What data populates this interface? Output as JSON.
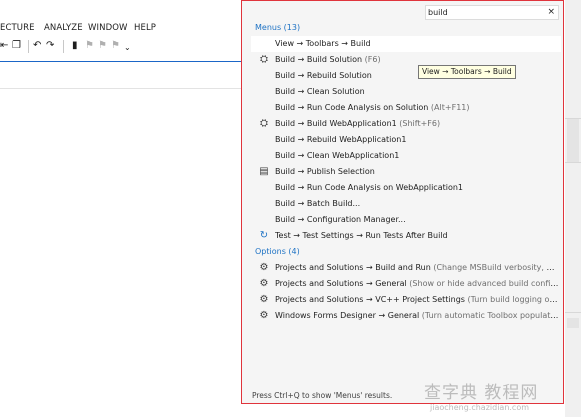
{
  "menubar": {
    "items": [
      "ECTURE",
      "ANALYZE",
      "WINDOW",
      "HELP"
    ]
  },
  "search": {
    "value": "build",
    "clear_glyph": "×"
  },
  "groups": {
    "menus_header": "Menus (13)",
    "options_header": "Options (4)"
  },
  "results": [
    {
      "text": "View → Toolbars → Build",
      "hint": "",
      "icon": "",
      "selected": true
    },
    {
      "text": "Build → Build Solution",
      "hint": " (F6)",
      "icon": "build-solution-icon",
      "selected": false
    },
    {
      "text": "Build → Rebuild Solution",
      "hint": "",
      "icon": "",
      "selected": false
    },
    {
      "text": "Build → Clean Solution",
      "hint": "",
      "icon": "",
      "selected": false
    },
    {
      "text": "Build → Run Code Analysis on Solution",
      "hint": " (Alt+F11)",
      "icon": "",
      "selected": false
    },
    {
      "text": "Build → Build WebApplication1",
      "hint": " (Shift+F6)",
      "icon": "build-project-icon",
      "selected": false
    },
    {
      "text": "Build → Rebuild WebApplication1",
      "hint": "",
      "icon": "",
      "selected": false
    },
    {
      "text": "Build → Clean WebApplication1",
      "hint": "",
      "icon": "",
      "selected": false
    },
    {
      "text": "Build → Publish Selection",
      "hint": "",
      "icon": "publish-icon",
      "selected": false
    },
    {
      "text": "Build → Run Code Analysis on WebApplication1",
      "hint": "",
      "icon": "",
      "selected": false
    },
    {
      "text": "Build → Batch Build...",
      "hint": "",
      "icon": "",
      "selected": false
    },
    {
      "text": "Build → Configuration Manager...",
      "hint": "",
      "icon": "",
      "selected": false
    },
    {
      "text": "Test → Test Settings → Run Tests After Build",
      "hint": "",
      "icon": "test-settings-icon",
      "selected": false
    }
  ],
  "options": [
    {
      "text": "Projects and Solutions → Build and Run",
      "hint": " (Change MSBuild verbosity, Change the nu..."
    },
    {
      "text": "Projects and Solutions → General",
      "hint": " (Show or hide advanced build configurations, Sho..."
    },
    {
      "text": "Projects and Solutions → VC++ Project Settings",
      "hint": " (Turn build logging on or off, Turn..."
    },
    {
      "text": "Windows Forms Designer → General",
      "hint": " (Turn automatic Toolbox population after rebui..."
    }
  ],
  "tooltip": "View → Toolbars → Build",
  "footer": "Press Ctrl+Q to show 'Menus' results.",
  "watermark": {
    "main": "查字典 教程网",
    "sub": "jiaocheng.chazidian.com"
  },
  "colors": {
    "accent_blue": "#1e72c4",
    "popup_border": "#e0343c",
    "tooltip_bg": "#ffffe1"
  }
}
